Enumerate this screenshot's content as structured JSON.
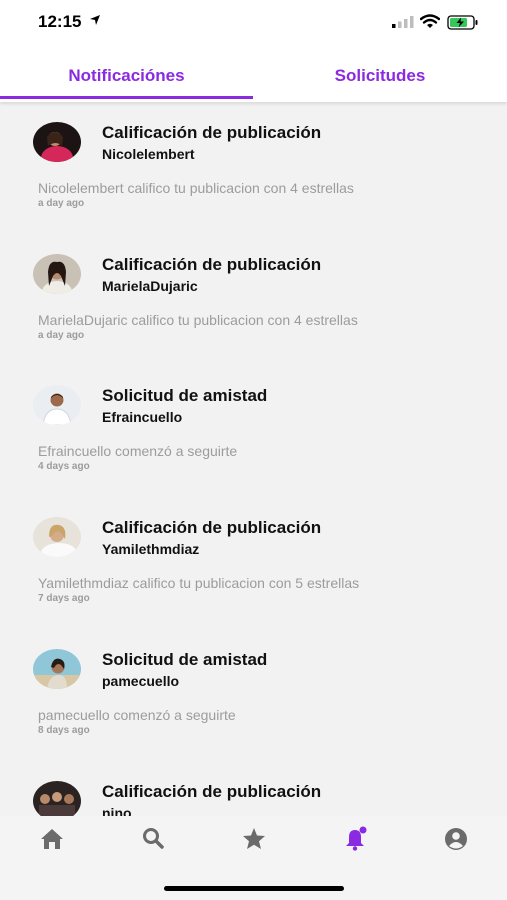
{
  "status_bar": {
    "time": "12:15"
  },
  "tabs": [
    {
      "label": "Notificaciónes",
      "active": true
    },
    {
      "label": "Solicitudes",
      "active": false
    }
  ],
  "accent_color": "#8a2be2",
  "notifications": [
    {
      "title": "Calificación de publicación",
      "user": "Nicolelembert",
      "message": "Nicolelembert califico tu publicacion con 4 estrellas",
      "time": "a day ago"
    },
    {
      "title": "Calificación de publicación",
      "user": "MarielaDujaric",
      "message": "MarielaDujaric califico tu publicacion con 4 estrellas",
      "time": "a day ago"
    },
    {
      "title": "Solicitud de amistad",
      "user": "Efraincuello",
      "message": "Efraincuello comenzó a seguirte",
      "time": "4 days ago"
    },
    {
      "title": "Calificación de publicación",
      "user": "Yamilethmdiaz",
      "message": "Yamilethmdiaz califico tu publicacion con 5 estrellas",
      "time": "7 days ago"
    },
    {
      "title": "Solicitud de amistad",
      "user": "pamecuello",
      "message": "pamecuello comenzó a seguirte",
      "time": "8 days ago"
    },
    {
      "title": "Calificación de publicación",
      "user": "nino",
      "message": "",
      "time": ""
    }
  ],
  "bottom_nav": [
    {
      "icon": "home-icon",
      "active": false
    },
    {
      "icon": "search-icon",
      "active": false
    },
    {
      "icon": "star-icon",
      "active": false
    },
    {
      "icon": "bell-icon",
      "active": true
    },
    {
      "icon": "profile-icon",
      "active": false
    }
  ]
}
